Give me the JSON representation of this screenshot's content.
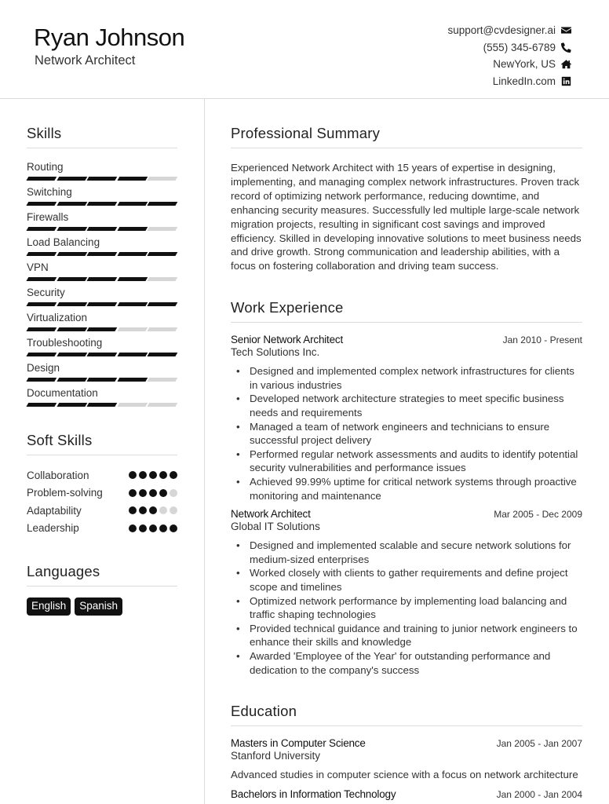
{
  "header": {
    "name": "Ryan Johnson",
    "title": "Network Architect",
    "contacts": [
      {
        "text": "support@cvdesigner.ai",
        "icon": "envelope-icon"
      },
      {
        "text": "(555) 345-6789",
        "icon": "phone-icon"
      },
      {
        "text": "NewYork, US",
        "icon": "home-icon"
      },
      {
        "text": "LinkedIn.com",
        "icon": "linkedin-icon"
      }
    ]
  },
  "skills": {
    "heading": "Skills",
    "max": 5,
    "items": [
      {
        "name": "Routing",
        "level": 4
      },
      {
        "name": "Switching",
        "level": 5
      },
      {
        "name": "Firewalls",
        "level": 4
      },
      {
        "name": "Load Balancing",
        "level": 5
      },
      {
        "name": "VPN",
        "level": 4
      },
      {
        "name": "Security",
        "level": 5
      },
      {
        "name": "Virtualization",
        "level": 3
      },
      {
        "name": "Troubleshooting",
        "level": 5
      },
      {
        "name": "Design",
        "level": 4
      },
      {
        "name": "Documentation",
        "level": 3
      }
    ]
  },
  "soft_skills": {
    "heading": "Soft Skills",
    "max": 5,
    "items": [
      {
        "name": "Collaboration",
        "level": 5
      },
      {
        "name": "Problem-solving",
        "level": 4
      },
      {
        "name": "Adaptability",
        "level": 3
      },
      {
        "name": "Leadership",
        "level": 5
      }
    ]
  },
  "languages": {
    "heading": "Languages",
    "items": [
      "English",
      "Spanish"
    ]
  },
  "summary": {
    "heading": "Professional Summary",
    "text": "Experienced Network Architect with 15 years of expertise in designing, implementing, and managing complex network infrastructures. Proven track record of optimizing network performance, reducing downtime, and enhancing security measures. Successfully led multiple large-scale network migration projects, resulting in significant cost savings and improved efficiency. Skilled in developing innovative solutions to meet business needs and drive growth. Strong communication and leadership abilities, with a focus on fostering collaboration and driving team success."
  },
  "experience": {
    "heading": "Work Experience",
    "jobs": [
      {
        "title": "Senior Network Architect",
        "dates": "Jan 2010 - Present",
        "company": "Tech Solutions Inc.",
        "bullets": [
          "Designed and implemented complex network infrastructures for clients in various industries",
          "Developed network architecture strategies to meet specific business needs and requirements",
          "Managed a team of network engineers and technicians to ensure successful project delivery",
          "Performed regular network assessments and audits to identify potential security vulnerabilities and performance issues",
          "Achieved 99.99% uptime for critical network systems through proactive monitoring and maintenance"
        ]
      },
      {
        "title": "Network Architect",
        "dates": "Mar 2005 - Dec 2009",
        "company": "Global IT Solutions",
        "bullets": [
          "Designed and implemented scalable and secure network solutions for medium-sized enterprises",
          "Worked closely with clients to gather requirements and define project scope and timelines",
          "Optimized network performance by implementing load balancing and traffic shaping technologies",
          "Provided technical guidance and training to junior network engineers to enhance their skills and knowledge",
          "Awarded 'Employee of the Year' for outstanding performance and dedication to the company's success"
        ]
      }
    ]
  },
  "education": {
    "heading": "Education",
    "items": [
      {
        "degree": "Masters in Computer Science",
        "dates": "Jan 2005 - Jan 2007",
        "school": "Stanford University",
        "description": "Advanced studies in computer science with a focus on network architecture"
      },
      {
        "degree": "Bachelors in Information Technology",
        "dates": "Jan 2000 - Jan 2004",
        "school": "",
        "description": ""
      }
    ]
  }
}
